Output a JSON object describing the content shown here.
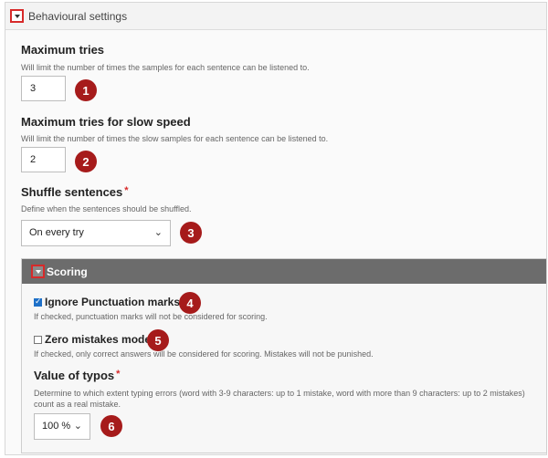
{
  "behavioural": {
    "title": "Behavioural settings",
    "maximum_tries": {
      "label": "Maximum tries",
      "description": "Will limit the number of times the samples for each sentence can be listened to.",
      "value": "3",
      "badge": "1"
    },
    "maximum_tries_slow": {
      "label": "Maximum tries for slow speed",
      "description": "Will limit the number of times the slow samples for each sentence can be listened to.",
      "value": "2",
      "badge": "2"
    },
    "shuffle": {
      "label": "Shuffle sentences",
      "required": "*",
      "description": "Define when the sentences should be shuffled.",
      "selected": "On every try",
      "badge": "3"
    }
  },
  "scoring": {
    "title": "Scoring",
    "ignore_punctuation": {
      "label": "Ignore Punctuation marks",
      "checked": true,
      "description": "If checked, punctuation marks will not be considered for scoring.",
      "badge": "4"
    },
    "zero_mistakes": {
      "label": "Zero mistakes mode",
      "checked": false,
      "description": "If checked, only correct answers will be considered for scoring. Mistakes will not be punished.",
      "badge": "5"
    },
    "typos": {
      "label": "Value of typos",
      "required": "*",
      "description_line1": "Determine to which extent typing errors (word with 3-9 characters: up to 1 mistake, word with more than 9 characters: up to 2 mistakes)",
      "description_line2": "count as a real mistake.",
      "selected": "100 %",
      "badge": "6"
    }
  },
  "colors": {
    "highlight_red": "#d72a2a",
    "badge_red": "#a61b1b",
    "scoring_header": "#6c6c6c",
    "checkbox_blue": "#1e70c8"
  },
  "icons": {
    "collapse": "chevron-down-icon",
    "select": "chevron-down-icon"
  }
}
